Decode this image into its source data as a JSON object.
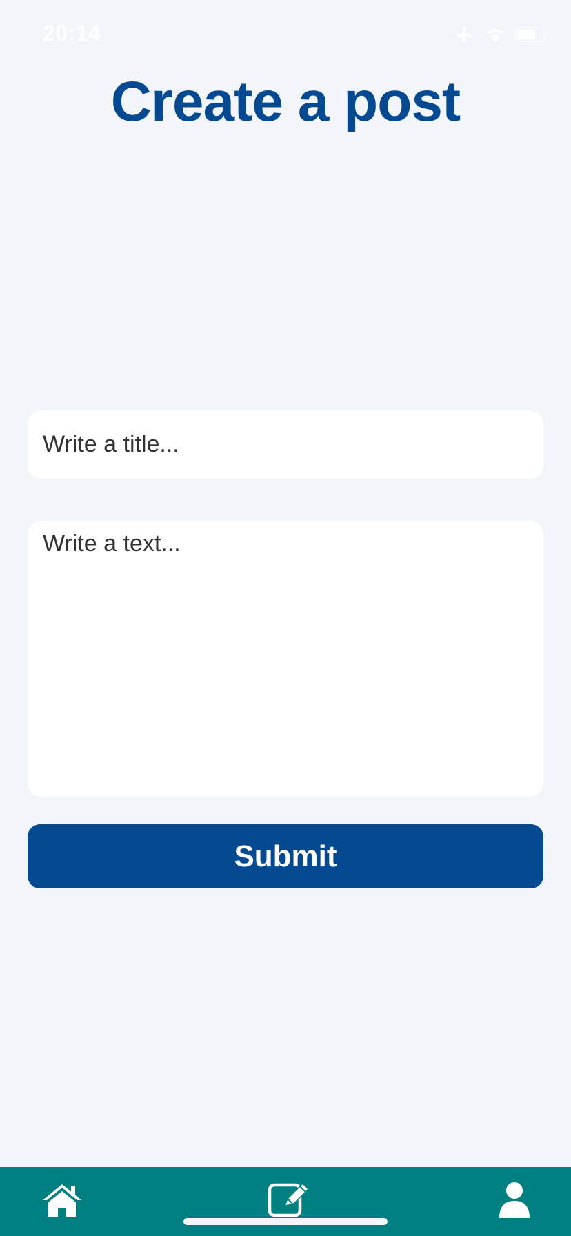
{
  "status_bar": {
    "time": "20:14"
  },
  "page": {
    "title": "Create a post"
  },
  "form": {
    "title_placeholder": "Write a title...",
    "text_placeholder": "Write a text...",
    "submit_label": "Submit"
  },
  "tab_bar": {
    "items": [
      {
        "icon": "home-icon"
      },
      {
        "icon": "edit-icon"
      },
      {
        "icon": "user-icon"
      }
    ]
  },
  "colors": {
    "background": "#f2f5fa",
    "title": "#054a91",
    "button": "#054a91",
    "tab_bar": "#008080"
  }
}
